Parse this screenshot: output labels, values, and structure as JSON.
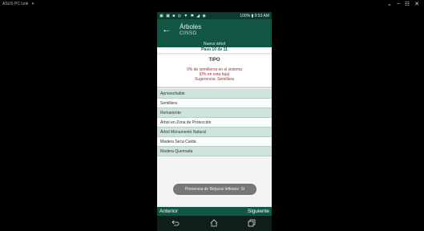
{
  "host": {
    "title": "ASUS PC Link",
    "title_symbol": "✦",
    "controls": "⌄ − ☷ ✕"
  },
  "status_bar": {
    "icons": "▣ ▣ ■ ◎ ▼ ✱ ◢ ◉",
    "battery": "100%",
    "time": "9:53 AM"
  },
  "app_bar": {
    "title": "Árboles",
    "subtitle": "CINSO"
  },
  "form": {
    "new_label": "Nuevo árbol",
    "step_label": "Paso 10 de 11",
    "section_title": "TIPO",
    "info_lines": [
      "0% de semilleros en el sistema",
      "(0% en esta faja)",
      "Sugerencia: Semillera"
    ],
    "options": [
      "Aprovechable",
      "Semillera",
      "Remanente",
      "Árbol en Zona de Protección",
      "Árbol Monumento Natural",
      "Madera Seca Caída",
      "Madera Quemada"
    ]
  },
  "toast": {
    "text": "Presencia de Bejucos lefiosos: Si"
  },
  "bottom_bar": {
    "prev": "Anterior",
    "next": "Siguiente"
  },
  "nav": {
    "icons": [
      "back-icon",
      "home-icon",
      "recents-icon"
    ]
  },
  "colors": {
    "primary_dark": "#145644",
    "status_bar": "#0d3b2e",
    "option_teal": "#cfe3dd",
    "alert_red": "#b02a2a"
  }
}
